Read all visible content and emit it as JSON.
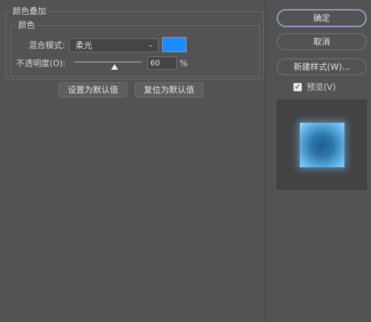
{
  "section": {
    "title": "颜色叠加",
    "group_title": "颜色"
  },
  "blend": {
    "label": "混合模式:",
    "value": "柔光"
  },
  "color": {
    "swatch": "#1a8cff"
  },
  "opacity": {
    "label": "不透明度(O):",
    "value": "60",
    "unit": "%",
    "level": 0.6
  },
  "defaults": {
    "set_label": "设置为默认值",
    "reset_label": "复位为默认值"
  },
  "side": {
    "ok_label": "确定",
    "cancel_label": "取消",
    "new_style_label": "新建样式(W)...",
    "preview_label": "预览(V)",
    "preview_checked": true
  }
}
